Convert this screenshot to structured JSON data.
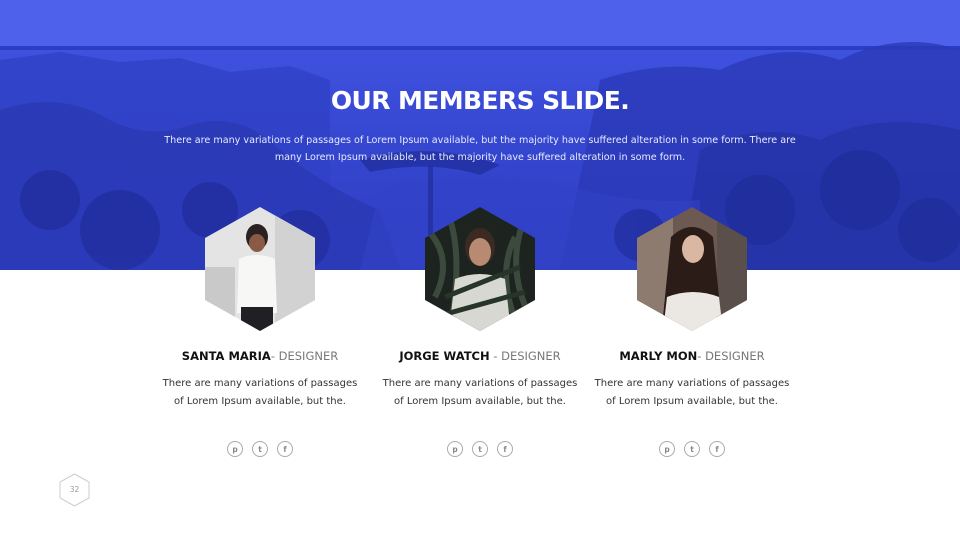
{
  "slide": {
    "title": "OUR MEMBERS SLIDE.",
    "subtitle": "There are many variations of passages of Lorem Ipsum available, but the majority have suffered alteration in some form. There are many Lorem Ipsum available, but the majority have suffered alteration in some form.",
    "page_number": "32"
  },
  "members": [
    {
      "name": "SANTA MARIA",
      "role": "- DESIGNER",
      "description": "There are many variations of passages of Lorem Ipsum available, but the.",
      "icons": [
        "pinterest-icon",
        "twitter-icon",
        "facebook-icon"
      ]
    },
    {
      "name": "JORGE WATCH",
      "role": " - DESIGNER",
      "description": "There are many variations of passages of Lorem Ipsum available, but the.",
      "icons": [
        "pinterest-icon",
        "twitter-icon",
        "facebook-icon"
      ]
    },
    {
      "name": "MARLY MON",
      "role": "- DESIGNER",
      "description": "There are many variations of passages of Lorem Ipsum available, but the.",
      "icons": [
        "pinterest-icon",
        "twitter-icon",
        "facebook-icon"
      ]
    }
  ],
  "colors": {
    "accent": "#3b4fe0",
    "text_dark": "#111111",
    "text_muted": "#777777"
  }
}
